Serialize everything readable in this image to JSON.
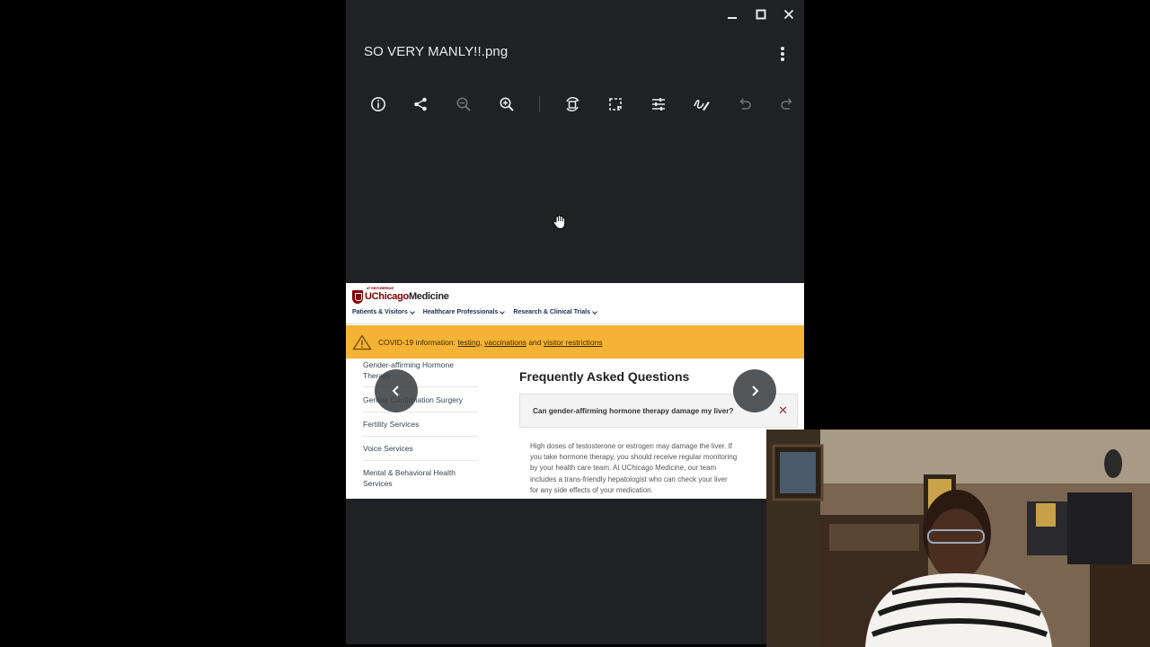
{
  "window": {
    "title": "SO VERY MANLY!!.png",
    "controls": [
      "minimize-icon",
      "maximize-icon",
      "close-icon"
    ]
  },
  "toolbar": {
    "buttons": [
      "info-icon",
      "share-icon",
      "zoom-out-icon",
      "zoom-in-icon",
      "rotate-icon",
      "crop-icon",
      "adjust-icon",
      "annotate-icon",
      "undo-icon",
      "redo-icon"
    ]
  },
  "image_content": {
    "logo": {
      "tagline": "AT THE FOREFRONT",
      "brand_part1": "UChicago",
      "brand_part2": "Medicine"
    },
    "nav": [
      "Patients & Visitors",
      "Healthcare Professionals",
      "Research & Clinical Trials"
    ],
    "covid_banner": {
      "prefix": "COVID-19 information:",
      "link1": "testing",
      "sep": ",",
      "link2": "vaccinations",
      "and": "and",
      "link3": "visitor restrictions"
    },
    "side_menu": [
      {
        "line1": "Gender-affirming Hormone",
        "line2": "Therapy"
      },
      {
        "line1": "Gender Confirmation Surgery"
      },
      {
        "line1": "Fertility Services"
      },
      {
        "line1": "Voice Services"
      },
      {
        "line1": "Mental & Behavioral Health",
        "line2": "Services"
      }
    ],
    "faq_heading": "Frequently Asked Questions",
    "faq_question": "Can gender-affirming hormone therapy damage my liver?",
    "faq_close": "✕",
    "faq_answer": [
      "High doses of testosterone or estrogen may damage the liver. If",
      "you take hormone therapy, you should receive regular monitoring",
      "by your health care team. At UChicago Medicine, our team",
      "includes a trans-friendly hepatologist who can check your liver",
      "for any side effects of your medication."
    ]
  },
  "colors": {
    "viewer_bg": "#202124",
    "banner": "#f5b335",
    "brand": "#800000"
  }
}
